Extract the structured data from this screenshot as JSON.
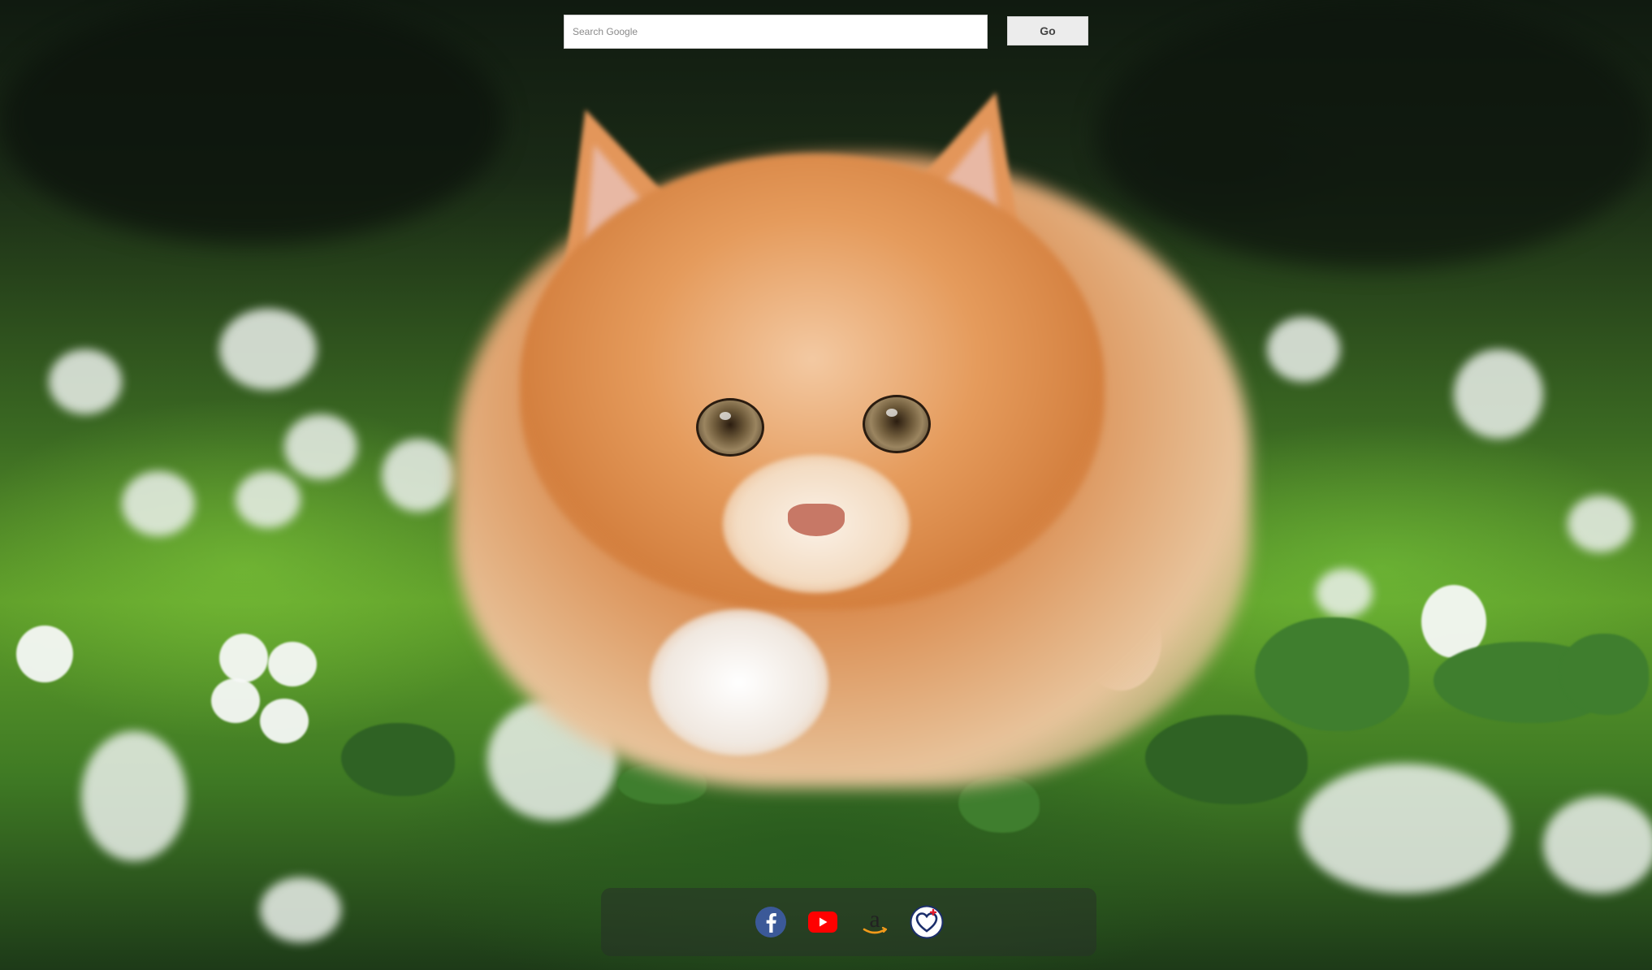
{
  "search": {
    "placeholder": "Search Google",
    "value": "",
    "go_label": "Go"
  },
  "dock": {
    "items": [
      {
        "icon": "facebook-icon",
        "color": "#3b5998"
      },
      {
        "icon": "youtube-icon",
        "color": "#ff0000"
      },
      {
        "icon": "amazon-icon",
        "color": "#222222"
      },
      {
        "icon": "heart-health-icon",
        "color": "#1b2e6b"
      }
    ]
  }
}
